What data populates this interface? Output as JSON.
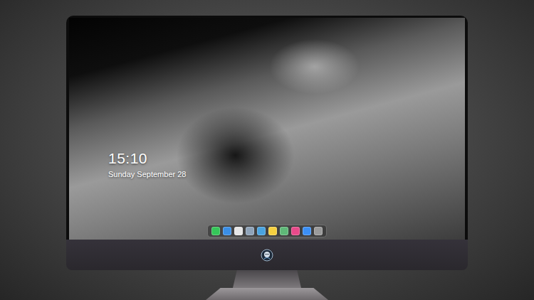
{
  "screen": {
    "clock": {
      "time": "15:10",
      "date": "Sunday September 28"
    }
  },
  "dock": {
    "items": [
      {
        "color": "#35c759"
      },
      {
        "color": "#3a8ee6"
      },
      {
        "color": "#e6e6e6"
      },
      {
        "color": "#8fa3b8"
      },
      {
        "color": "#4aa3df"
      },
      {
        "color": "#f5d040"
      },
      {
        "color": "#5fb878"
      },
      {
        "color": "#e84a8a"
      },
      {
        "color": "#3b8ff5"
      },
      {
        "color": "#9a9a9a"
      }
    ]
  }
}
